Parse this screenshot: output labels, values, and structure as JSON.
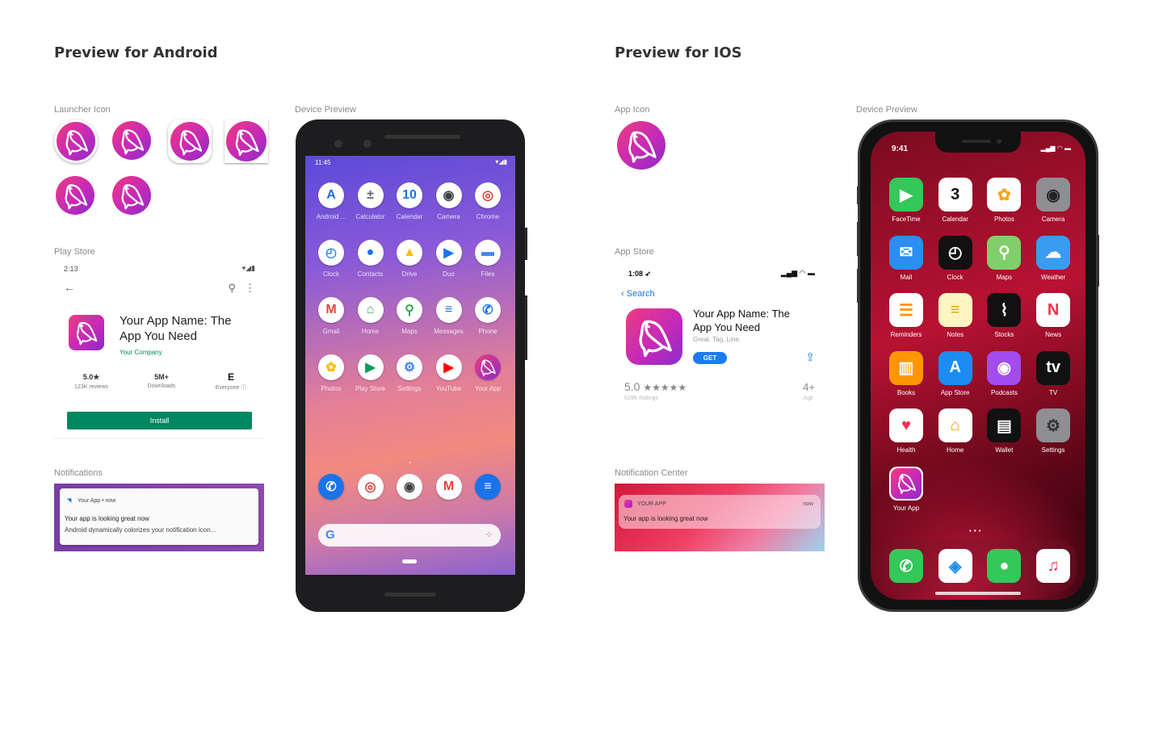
{
  "android": {
    "heading": "Preview for Android",
    "launcher_label": "Launcher Icon",
    "device_label": "Device Preview",
    "play_label": "Play Store",
    "notif_label": "Notifications",
    "play": {
      "time": "2:13",
      "title": "Your App Name: The App You Need",
      "company": "Your Company",
      "rating": "5.0★",
      "rating_sub": "123K reviews",
      "downloads": "5M+",
      "downloads_sub": "Downloads",
      "content_rating": "E",
      "content_sub": "Everyone ⓘ",
      "install": "Install"
    },
    "notification": {
      "app": "Your App",
      "time": "now",
      "title": "Your app is looking great now",
      "body": "Android dynamically colorizes your notification icon..."
    },
    "phone": {
      "time": "11:45",
      "apps": [
        {
          "name": "Android ...",
          "icon": "android-auto-icon",
          "color": "#1f6fd8",
          "glyph": "A"
        },
        {
          "name": "Calculator",
          "icon": "calculator-icon",
          "color": "#5f6368",
          "glyph": "±"
        },
        {
          "name": "Calendar",
          "icon": "calendar-icon",
          "color": "#1a73e8",
          "glyph": "10"
        },
        {
          "name": "Camera",
          "icon": "camera-icon",
          "color": "#3c4043",
          "glyph": "◉"
        },
        {
          "name": "Chrome",
          "icon": "chrome-icon",
          "color": "#db4437",
          "glyph": "◎"
        },
        {
          "name": "Clock",
          "icon": "clock-icon",
          "color": "#4285f4",
          "glyph": "◴"
        },
        {
          "name": "Contacts",
          "icon": "contacts-icon",
          "color": "#1a73e8",
          "glyph": "●"
        },
        {
          "name": "Drive",
          "icon": "drive-icon",
          "color": "#fbbc04",
          "glyph": "▲"
        },
        {
          "name": "Duo",
          "icon": "duo-icon",
          "color": "#1a73e8",
          "glyph": "▶"
        },
        {
          "name": "Files",
          "icon": "files-icon",
          "color": "#4285f4",
          "glyph": "▬"
        },
        {
          "name": "Gmail",
          "icon": "gmail-icon",
          "color": "#ea4335",
          "glyph": "M"
        },
        {
          "name": "Home",
          "icon": "home-icon",
          "color": "#34a853",
          "glyph": "⌂"
        },
        {
          "name": "Maps",
          "icon": "maps-icon",
          "color": "#34a853",
          "glyph": "⚲"
        },
        {
          "name": "Messages",
          "icon": "messages-icon",
          "color": "#1a73e8",
          "glyph": "≡"
        },
        {
          "name": "Phone",
          "icon": "phone-icon",
          "color": "#1a73e8",
          "glyph": "✆"
        },
        {
          "name": "Photos",
          "icon": "photos-icon",
          "color": "#fbbc04",
          "glyph": "✿"
        },
        {
          "name": "Play Store",
          "icon": "play-store-icon",
          "color": "#0f9d58",
          "glyph": "▶"
        },
        {
          "name": "Settings",
          "icon": "settings-icon",
          "color": "#4285f4",
          "glyph": "⚙"
        },
        {
          "name": "YouTube",
          "icon": "youtube-icon",
          "color": "#ff0000",
          "glyph": "▶"
        },
        {
          "name": "Your App",
          "icon": "your-app-icon",
          "color": "#d42a9a",
          "glyph": ""
        }
      ],
      "dock": [
        {
          "icon": "phone-icon",
          "color": "#1a73e8",
          "glyph": "✆"
        },
        {
          "icon": "chrome-icon",
          "color": "#db4437",
          "glyph": "◎"
        },
        {
          "icon": "camera-icon",
          "color": "#3c4043",
          "glyph": "◉"
        },
        {
          "icon": "gmail-icon",
          "color": "#ea4335",
          "glyph": "M"
        },
        {
          "icon": "messages-icon",
          "color": "#1a73e8",
          "glyph": "≡"
        }
      ]
    }
  },
  "ios": {
    "heading": "Preview for IOS",
    "app_icon_label": "App Icon",
    "device_label": "Device Preview",
    "store_label": "App Store",
    "notif_label": "Notification Center",
    "store": {
      "time": "1:08 ➶",
      "back": "Search",
      "title": "Your App Name: The App You Need",
      "tagline": "Great. Tag. Line.",
      "get": "GET",
      "rating": "5.0",
      "stars": "★★★★★",
      "ratings_sub": "629K Ratings",
      "age": "4+",
      "age_sub": "Age"
    },
    "notification": {
      "app": "YOUR APP",
      "time": "now",
      "body": "Your app is looking great now"
    },
    "phone": {
      "time": "9:41",
      "apps": [
        {
          "name": "FaceTime",
          "icon": "facetime-icon",
          "color": "#34c759",
          "glyph": "▶",
          "fg": "#fff"
        },
        {
          "name": "Calendar",
          "icon": "calendar-icon",
          "color": "#ffffff",
          "glyph": "3",
          "fg": "#111",
          "sub": "Monday"
        },
        {
          "name": "Photos",
          "icon": "photos-icon",
          "color": "#ffffff",
          "glyph": "✿",
          "fg": "#f5a623"
        },
        {
          "name": "Camera",
          "icon": "camera-icon",
          "color": "#8e8e93",
          "glyph": "◉",
          "fg": "#222"
        },
        {
          "name": "Mail",
          "icon": "mail-icon",
          "color": "#2b8ef0",
          "glyph": "✉",
          "fg": "#fff"
        },
        {
          "name": "Clock",
          "icon": "clock-icon",
          "color": "#111111",
          "glyph": "◴",
          "fg": "#fff"
        },
        {
          "name": "Maps",
          "icon": "maps-icon",
          "color": "#7fd06a",
          "glyph": "⚲",
          "fg": "#fff"
        },
        {
          "name": "Weather",
          "icon": "weather-icon",
          "color": "#3a9cf0",
          "glyph": "☁",
          "fg": "#fff"
        },
        {
          "name": "Reminders",
          "icon": "reminders-icon",
          "color": "#ffffff",
          "glyph": "☰",
          "fg": "#ff9500"
        },
        {
          "name": "Notes",
          "icon": "notes-icon",
          "color": "#fff5c2",
          "glyph": "≡",
          "fg": "#d9a400"
        },
        {
          "name": "Stocks",
          "icon": "stocks-icon",
          "color": "#111111",
          "glyph": "⌇",
          "fg": "#fff"
        },
        {
          "name": "News",
          "icon": "news-icon",
          "color": "#ffffff",
          "glyph": "N",
          "fg": "#f0334f"
        },
        {
          "name": "Books",
          "icon": "books-icon",
          "color": "#ff9500",
          "glyph": "▥",
          "fg": "#fff"
        },
        {
          "name": "App Store",
          "icon": "app-store-icon",
          "color": "#1c8cf2",
          "glyph": "A",
          "fg": "#fff"
        },
        {
          "name": "Podcasts",
          "icon": "podcasts-icon",
          "color": "#a24cf0",
          "glyph": "◉",
          "fg": "#fff"
        },
        {
          "name": "TV",
          "icon": "tv-icon",
          "color": "#111111",
          "glyph": "tv",
          "fg": "#fff"
        },
        {
          "name": "Health",
          "icon": "health-icon",
          "color": "#ffffff",
          "glyph": "♥",
          "fg": "#ff2d55"
        },
        {
          "name": "Home",
          "icon": "home-icon",
          "color": "#ffffff",
          "glyph": "⌂",
          "fg": "#ff9500"
        },
        {
          "name": "Wallet",
          "icon": "wallet-icon",
          "color": "#111111",
          "glyph": "▤",
          "fg": "#fff"
        },
        {
          "name": "Settings",
          "icon": "settings-icon",
          "color": "#8e8e93",
          "glyph": "⚙",
          "fg": "#333"
        },
        {
          "name": "Your App",
          "icon": "your-app-icon",
          "color": "#ffffff",
          "glyph": "",
          "fg": "#fff"
        }
      ],
      "dock": [
        {
          "icon": "phone-icon",
          "color": "#34c759",
          "glyph": "✆",
          "fg": "#fff"
        },
        {
          "icon": "safari-icon",
          "color": "#ffffff",
          "glyph": "◈",
          "fg": "#1c8cf2"
        },
        {
          "icon": "messages-icon",
          "color": "#34c759",
          "glyph": "●",
          "fg": "#fff"
        },
        {
          "icon": "music-icon",
          "color": "#ffffff",
          "glyph": "♫",
          "fg": "#fa2d55"
        }
      ]
    }
  }
}
